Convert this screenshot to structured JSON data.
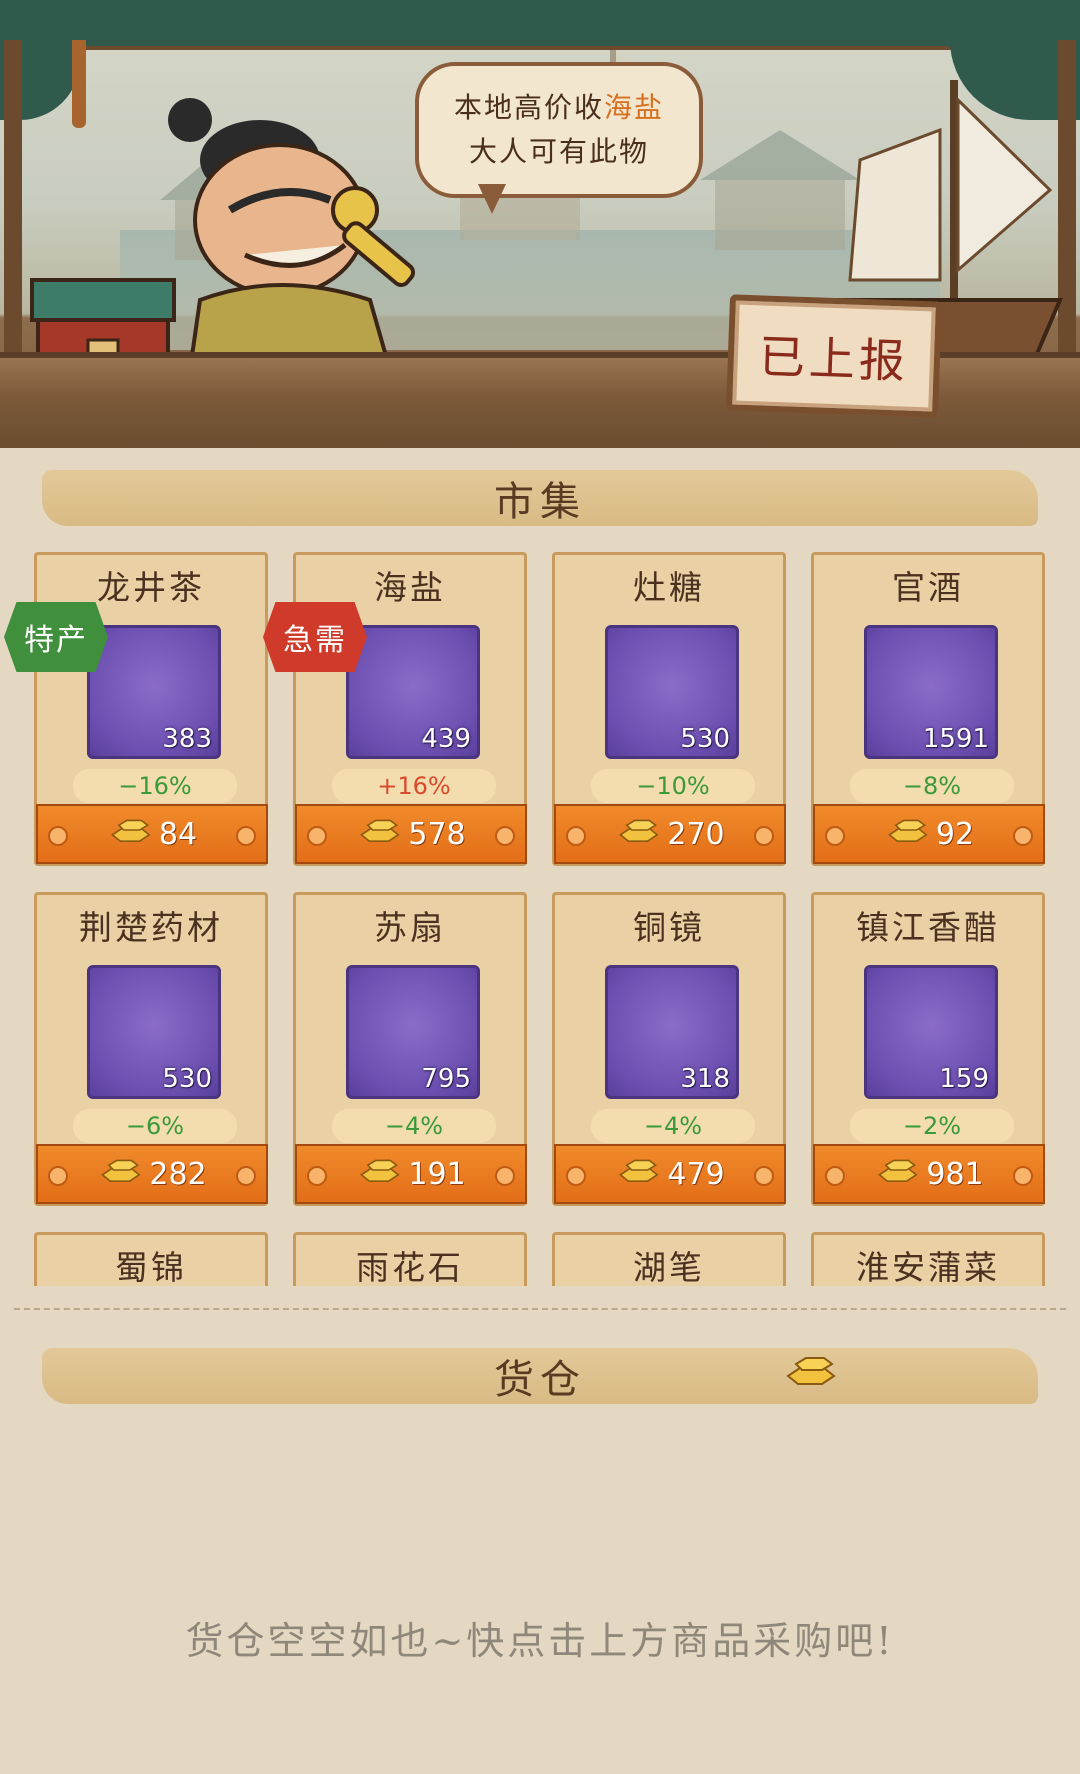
{
  "speech": {
    "line1_prefix": "本地高价收",
    "line1_highlight": "海盐",
    "line2": "大人可有此物"
  },
  "report_sign": "已上报",
  "market": {
    "title": "市集",
    "items": [
      {
        "name": "龙井茶",
        "qty": "383",
        "change": "−16%",
        "trend": "down",
        "price": "84",
        "tag": "特产",
        "tag_color": "#3f8f3c",
        "icon": "tea-cup-icon"
      },
      {
        "name": "海盐",
        "qty": "439",
        "change": "+16%",
        "trend": "up",
        "price": "578",
        "tag": "急需",
        "tag_color": "#cf3a2a",
        "icon": "salt-jar-icon"
      },
      {
        "name": "灶糖",
        "qty": "530",
        "change": "−10%",
        "trend": "down",
        "price": "270",
        "icon": "candy-plate-icon"
      },
      {
        "name": "官酒",
        "qty": "1591",
        "change": "−8%",
        "trend": "down",
        "price": "92",
        "icon": "wine-vase-icon"
      },
      {
        "name": "荆楚药材",
        "qty": "530",
        "change": "−6%",
        "trend": "down",
        "price": "282",
        "icon": "herb-basket-icon"
      },
      {
        "name": "苏扇",
        "qty": "795",
        "change": "−4%",
        "trend": "down",
        "price": "191",
        "icon": "bamboo-fan-icon"
      },
      {
        "name": "铜镜",
        "qty": "318",
        "change": "−4%",
        "trend": "down",
        "price": "479",
        "icon": "bronze-mirror-icon"
      },
      {
        "name": "镇江香醋",
        "qty": "159",
        "change": "−2%",
        "trend": "down",
        "price": "981",
        "icon": "vinegar-jar-icon"
      },
      {
        "name": "蜀锦"
      },
      {
        "name": "雨花石"
      },
      {
        "name": "湖笔"
      },
      {
        "name": "淮安蒲菜"
      }
    ]
  },
  "warehouse": {
    "title": "货仓",
    "empty_message": "货仓空空如也~快点击上方商品采购吧!"
  },
  "colors": {
    "price_bar": "#e97b20",
    "down": "#3a9a3a",
    "up": "#d84a2e",
    "item_bg": "#6c4fb0"
  }
}
